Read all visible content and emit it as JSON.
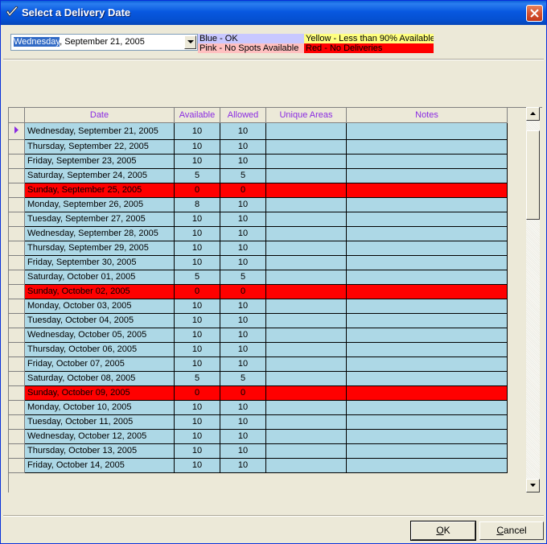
{
  "window": {
    "title": "Select a Delivery Date"
  },
  "date_select": {
    "selected_day": "Wednesday",
    "selected_rest": ", September 21, 2005"
  },
  "legend": {
    "blue": "Blue - OK",
    "yellow": "Yellow - Less than 90% Available",
    "pink": "Pink - No Spots Available",
    "red": "Red - No Deliveries"
  },
  "colors": {
    "blue": "#add8e6",
    "red": "#ff0000",
    "legend_blue": "#c8c8ff",
    "legend_yellow": "#ffff80",
    "legend_pink": "#ffc0c0",
    "header_text": "#8a2be2"
  },
  "grid": {
    "columns": [
      "Date",
      "Available",
      "Allowed",
      "Unique Areas",
      "Notes"
    ],
    "rows": [
      {
        "date": "Wednesday, September 21, 2005",
        "available": "10",
        "allowed": "10",
        "status": "blue",
        "current": true
      },
      {
        "date": "Thursday, September 22, 2005",
        "available": "10",
        "allowed": "10",
        "status": "blue"
      },
      {
        "date": "Friday, September 23, 2005",
        "available": "10",
        "allowed": "10",
        "status": "blue"
      },
      {
        "date": "Saturday, September 24, 2005",
        "available": "5",
        "allowed": "5",
        "status": "blue"
      },
      {
        "date": "Sunday, September 25, 2005",
        "available": "0",
        "allowed": "0",
        "status": "red"
      },
      {
        "date": "Monday, September 26, 2005",
        "available": "8",
        "allowed": "10",
        "status": "blue"
      },
      {
        "date": "Tuesday, September 27, 2005",
        "available": "10",
        "allowed": "10",
        "status": "blue"
      },
      {
        "date": "Wednesday, September 28, 2005",
        "available": "10",
        "allowed": "10",
        "status": "blue"
      },
      {
        "date": "Thursday, September 29, 2005",
        "available": "10",
        "allowed": "10",
        "status": "blue"
      },
      {
        "date": "Friday, September 30, 2005",
        "available": "10",
        "allowed": "10",
        "status": "blue"
      },
      {
        "date": "Saturday, October 01, 2005",
        "available": "5",
        "allowed": "5",
        "status": "blue"
      },
      {
        "date": "Sunday, October 02, 2005",
        "available": "0",
        "allowed": "0",
        "status": "red"
      },
      {
        "date": "Monday, October 03, 2005",
        "available": "10",
        "allowed": "10",
        "status": "blue"
      },
      {
        "date": "Tuesday, October 04, 2005",
        "available": "10",
        "allowed": "10",
        "status": "blue"
      },
      {
        "date": "Wednesday, October 05, 2005",
        "available": "10",
        "allowed": "10",
        "status": "blue"
      },
      {
        "date": "Thursday, October 06, 2005",
        "available": "10",
        "allowed": "10",
        "status": "blue"
      },
      {
        "date": "Friday, October 07, 2005",
        "available": "10",
        "allowed": "10",
        "status": "blue"
      },
      {
        "date": "Saturday, October 08, 2005",
        "available": "5",
        "allowed": "5",
        "status": "blue"
      },
      {
        "date": "Sunday, October 09, 2005",
        "available": "0",
        "allowed": "0",
        "status": "red"
      },
      {
        "date": "Monday, October 10, 2005",
        "available": "10",
        "allowed": "10",
        "status": "blue"
      },
      {
        "date": "Tuesday, October 11, 2005",
        "available": "10",
        "allowed": "10",
        "status": "blue"
      },
      {
        "date": "Wednesday, October 12, 2005",
        "available": "10",
        "allowed": "10",
        "status": "blue"
      },
      {
        "date": "Thursday, October 13, 2005",
        "available": "10",
        "allowed": "10",
        "status": "blue"
      },
      {
        "date": "Friday, October 14, 2005",
        "available": "10",
        "allowed": "10",
        "status": "blue"
      }
    ]
  },
  "buttons": {
    "ok": {
      "accel": "O",
      "rest": "K"
    },
    "cancel": {
      "accel": "C",
      "rest": "ancel"
    }
  }
}
